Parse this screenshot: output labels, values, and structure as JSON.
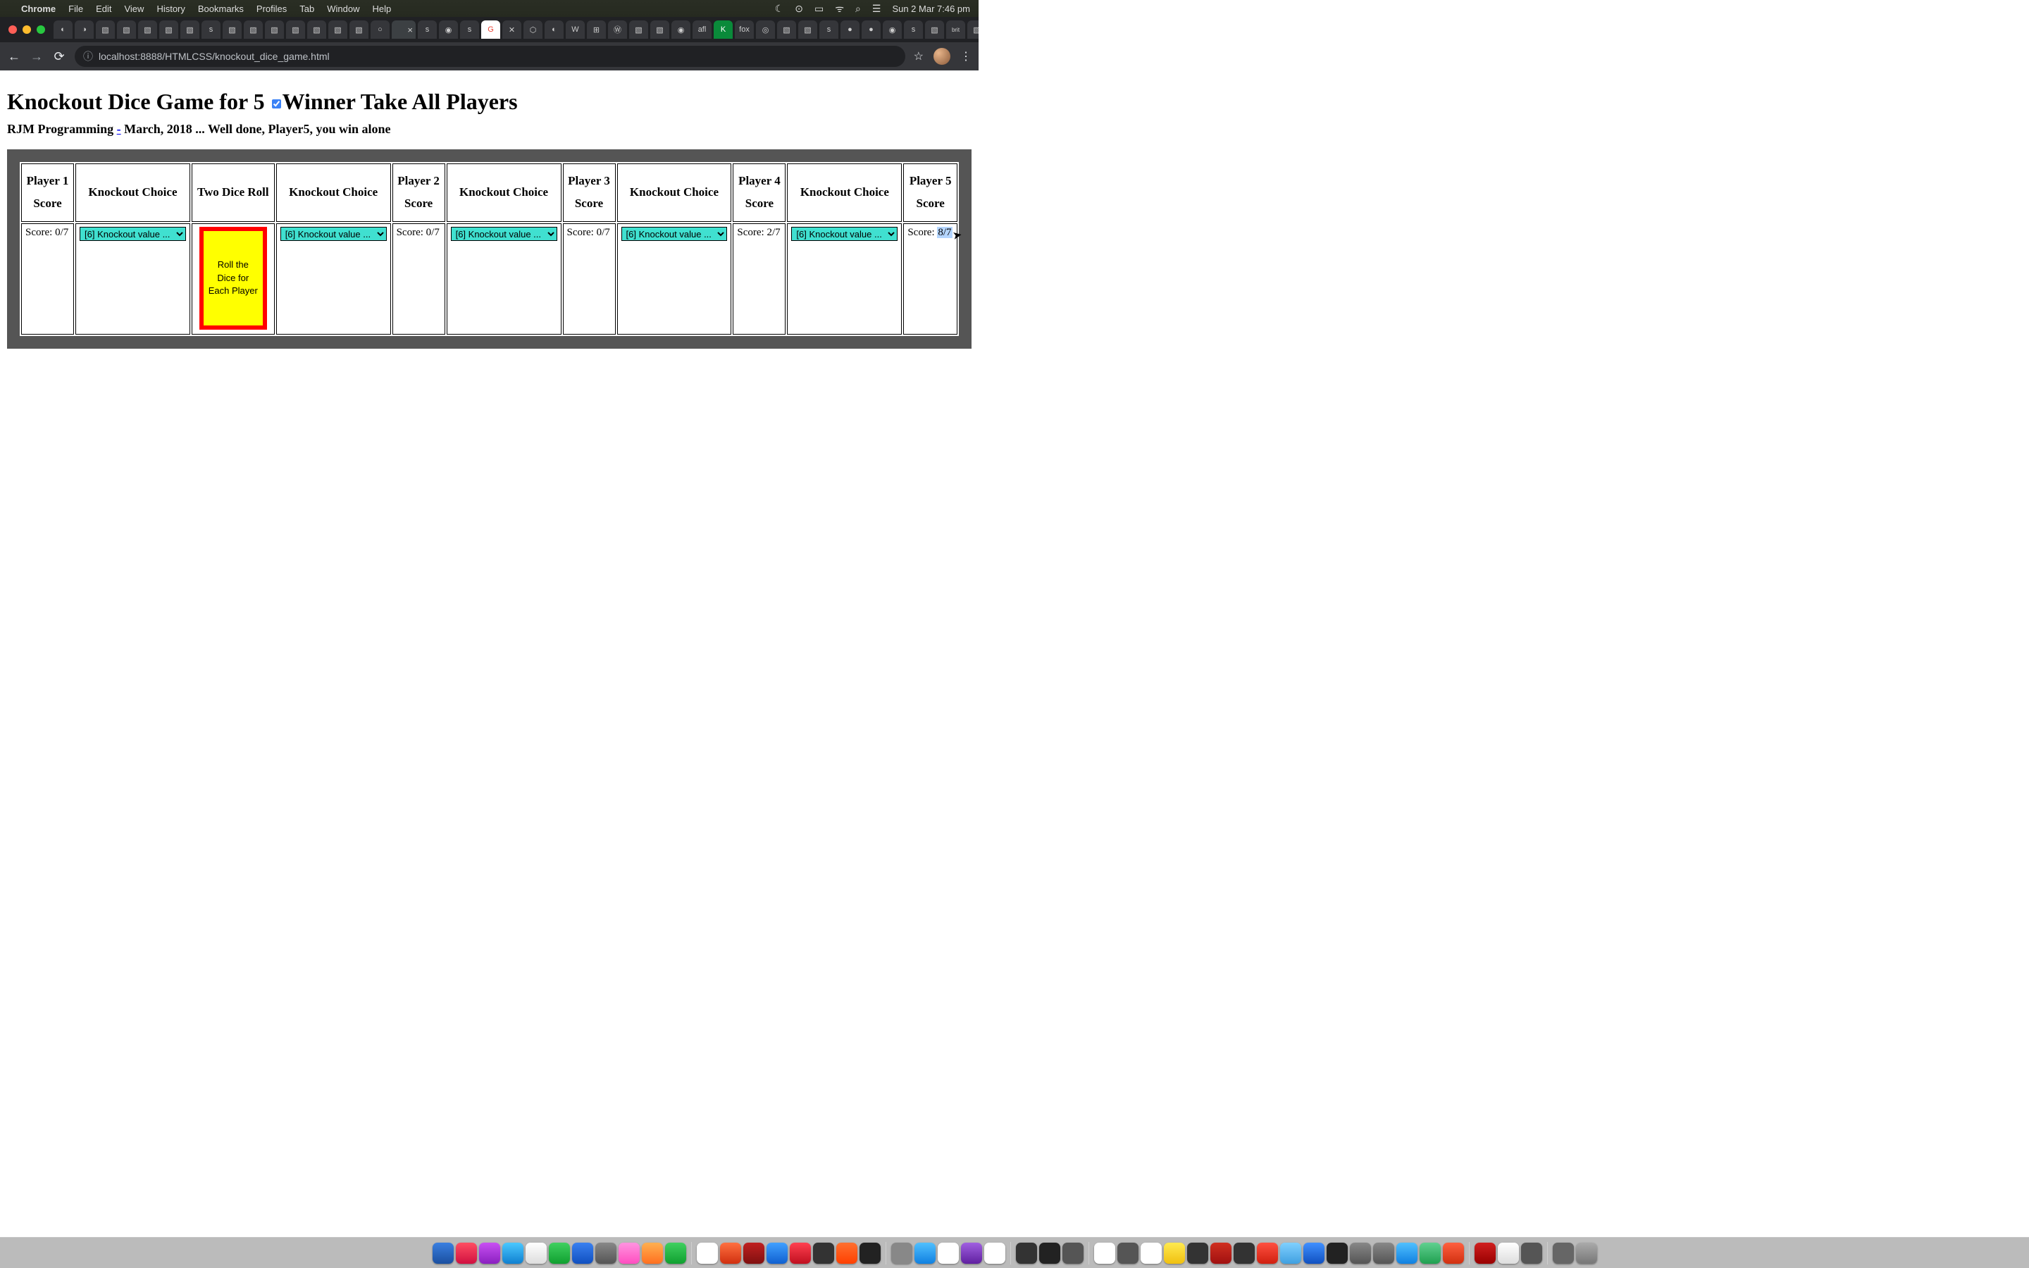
{
  "menubar": {
    "apple": "",
    "appname": "Chrome",
    "items": [
      "File",
      "Edit",
      "View",
      "History",
      "Bookmarks",
      "Profiles",
      "Tab",
      "Window",
      "Help"
    ],
    "right": {
      "moon": "☾",
      "play": "⊙",
      "battery": "▭",
      "wifi": "ᯤ",
      "search": "⌕",
      "control": "☰",
      "datetime": "Sun 2 Mar  7:46 pm"
    }
  },
  "browser": {
    "url": "localhost:8888/HTMLCSS/knockout_dice_game.html",
    "info_icon": "ⓘ",
    "star": "☆",
    "back": "←",
    "forward": "→",
    "reload": "⟳",
    "menu": "⋮",
    "tab_plus": "+",
    "tab_expand": "⌄"
  },
  "page": {
    "title_a": "Knockout Dice Game for 5 ",
    "title_b": "Winner Take All Players",
    "subtitle_prefix": "RJM Programming ",
    "subtitle_dash": "-",
    "subtitle_rest": " March, 2018 ... Well done, Player5, you win alone",
    "headers": {
      "p1": "Player 1",
      "p2": "Player 2",
      "p3": "Player 3",
      "p4": "Player 4",
      "p5": "Player 5",
      "score": "Score",
      "ko": "Knockout Choice",
      "roll": "Two Dice Roll"
    },
    "scores": {
      "p1": "Score: 0/7",
      "p2": "Score: 0/7",
      "p3": "Score: 0/7",
      "p4": "Score: 2/7",
      "p5_pre": "Score: ",
      "p5_hl": "8/7"
    },
    "select_label": "[6] Knockout value ...",
    "dice_button": "Roll the Dice for Each Player"
  }
}
